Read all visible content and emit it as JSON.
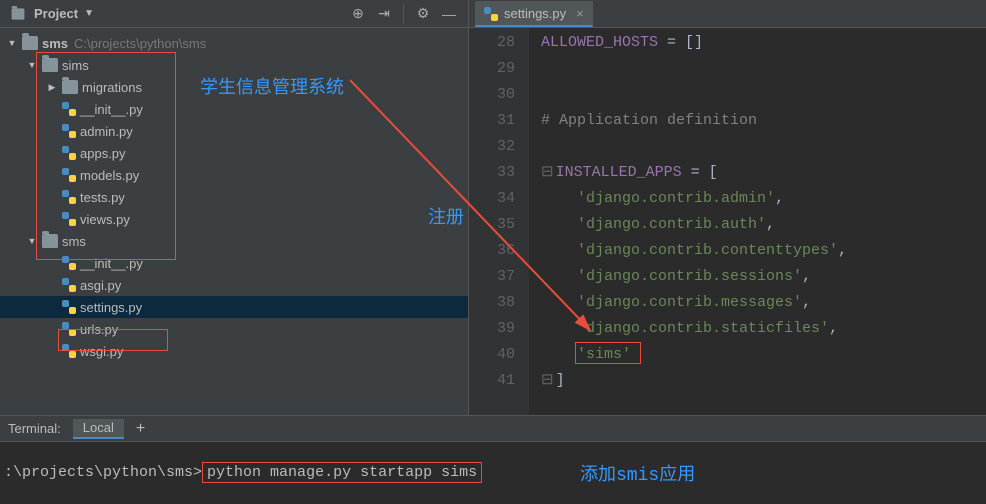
{
  "project": {
    "title": "Project",
    "root": {
      "name": "sms",
      "path": "C:\\projects\\python\\sms"
    },
    "sims": {
      "name": "sims",
      "migrations": "migrations",
      "files": [
        "__init__.py",
        "admin.py",
        "apps.py",
        "models.py",
        "tests.py",
        "views.py"
      ]
    },
    "sms": {
      "name": "sms",
      "files": [
        "__init__.py",
        "asgi.py",
        "settings.py",
        "urls.py",
        "wsgi.py"
      ]
    }
  },
  "tab": {
    "name": "settings.py"
  },
  "gutter": [
    "28",
    "29",
    "30",
    "31",
    "32",
    "33",
    "34",
    "35",
    "36",
    "37",
    "38",
    "39",
    "40",
    "41"
  ],
  "code": {
    "l28": {
      "a": "ALLOWED_HOSTS",
      "b": " = []"
    },
    "l31": "# Application definition",
    "l33": {
      "a": "INSTALLED_APPS",
      "b": " = ["
    },
    "l34": "'django.contrib.admin'",
    "l35": "'django.contrib.auth'",
    "l36": "'django.contrib.contenttypes'",
    "l37": "'django.contrib.sessions'",
    "l38": "'django.contrib.messages'",
    "l39": "'django.contrib.staticfiles'",
    "l40": "'sims'",
    "l41": "]",
    "comma": ","
  },
  "terminal": {
    "title": "Terminal:",
    "tab": "Local",
    "prompt": ":\\projects\\python\\sms>",
    "cmd": "python manage.py startapp sims"
  },
  "annotations": {
    "system": "学生信息管理系统",
    "register": "注册",
    "addapp": "添加smis应用"
  }
}
